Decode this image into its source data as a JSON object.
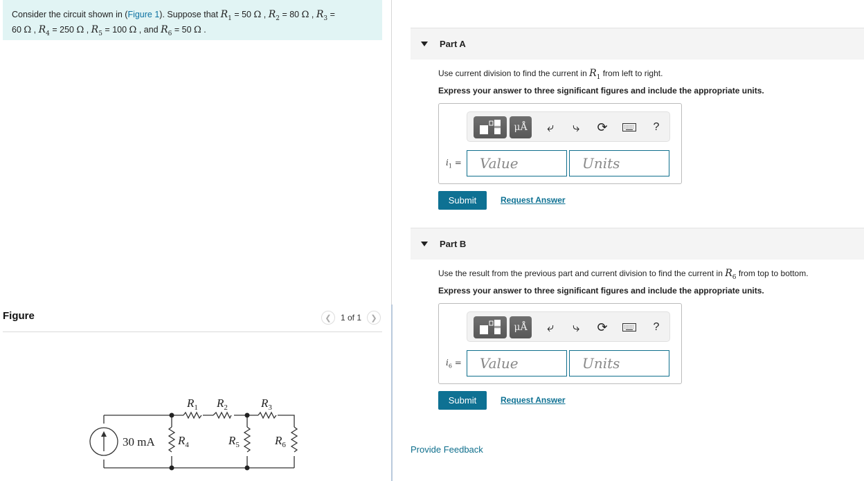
{
  "problem": {
    "intro": "Consider the circuit shown in (",
    "figure_link": "Figure 1",
    "after_link": "). Suppose that ",
    "values": [
      {
        "name": "R",
        "sub": "1",
        "value": "50",
        "unit": "Ω"
      },
      {
        "name": "R",
        "sub": "2",
        "value": "80",
        "unit": "Ω"
      },
      {
        "name": "R",
        "sub": "3",
        "value": "60",
        "unit": "Ω"
      },
      {
        "name": "R",
        "sub": "4",
        "value": "250",
        "unit": "Ω"
      },
      {
        "name": "R",
        "sub": "5",
        "value": "100",
        "unit": "Ω"
      },
      {
        "name": "R",
        "sub": "6",
        "value": "50",
        "unit": "Ω"
      }
    ],
    "and_word": "and"
  },
  "figure": {
    "title": "Figure",
    "pager_text": "1 of 1",
    "prev_icon": "chevron-left",
    "next_icon": "chevron-right",
    "circuit": {
      "source_label": "30 mA",
      "labels": [
        "R1",
        "R2",
        "R3",
        "R4",
        "R5",
        "R6"
      ]
    }
  },
  "parts": [
    {
      "title": "Part A",
      "instruction_pre": "Use current division to find the current in ",
      "instruction_var": "R",
      "instruction_sub": "1",
      "instruction_post": " from left to right.",
      "express": "Express your answer to three significant figures and include the appropriate units.",
      "answer_var": "i",
      "answer_sub": "1",
      "value_placeholder": "Value",
      "units_placeholder": "Units",
      "submit_label": "Submit",
      "request_label": "Request Answer"
    },
    {
      "title": "Part B",
      "instruction_pre": "Use the result from the previous part and current division to find the current in ",
      "instruction_var": "R",
      "instruction_sub": "6",
      "instruction_post": " from top to bottom.",
      "express": "Express your answer to three significant figures and include the appropriate units.",
      "answer_var": "i",
      "answer_sub": "6",
      "value_placeholder": "Value",
      "units_placeholder": "Units",
      "submit_label": "Submit",
      "request_label": "Request Answer"
    }
  ],
  "toolbar": {
    "units_btn": "μÅ",
    "help": "?",
    "icons": [
      "templates-icon",
      "units-icon",
      "undo-icon",
      "redo-icon",
      "reset-icon",
      "keyboard-icon",
      "help-icon"
    ]
  },
  "footer": {
    "feedback_label": "Provide Feedback"
  },
  "colors": {
    "accent": "#0e7193",
    "problem_bg": "#e1f4f4",
    "part_header_bg": "#f4f4f4",
    "field_border": "#0e6e8c"
  }
}
